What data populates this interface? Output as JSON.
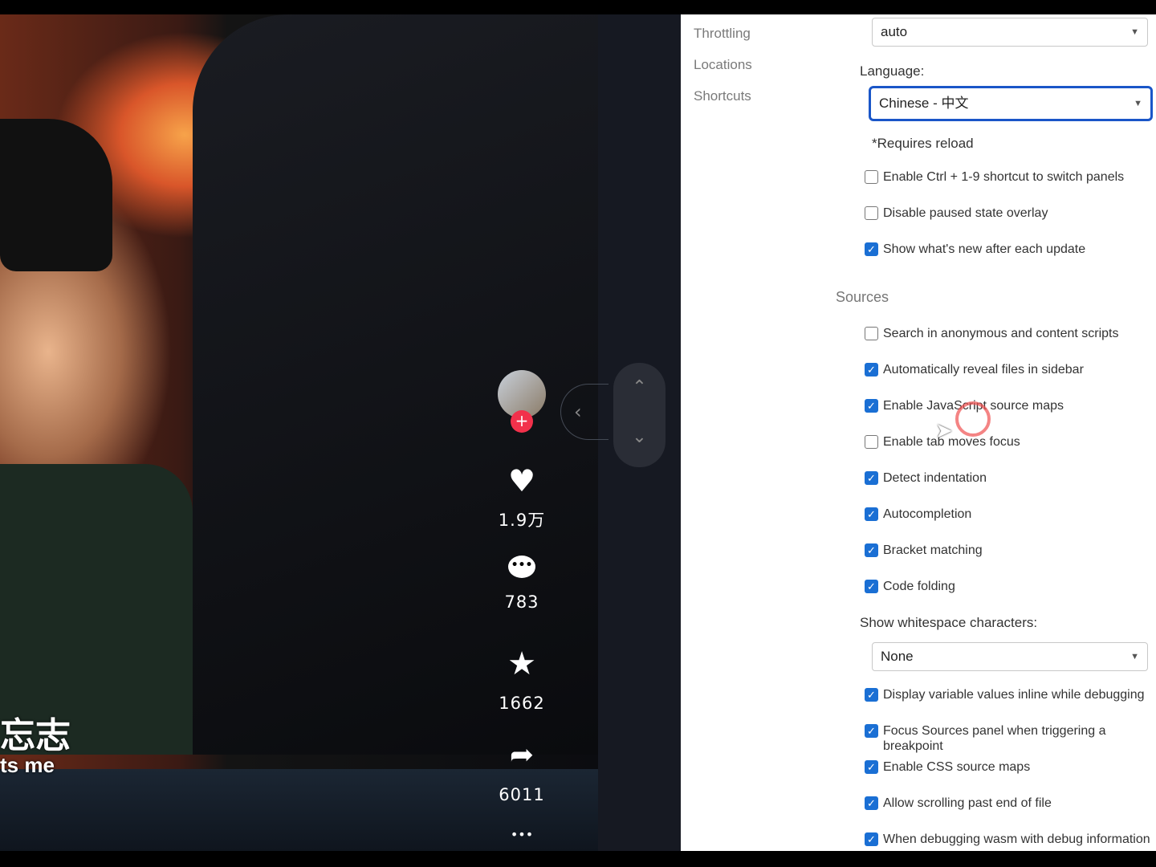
{
  "video": {
    "subtitle_cn": "忘志",
    "subtitle_en": "ts me"
  },
  "actions": {
    "likes": "1.9万",
    "comments": "783",
    "favorites": "1662",
    "shares": "6011",
    "more": "•••",
    "follow": "+"
  },
  "nav_arrows": {
    "up": "⌃",
    "down": "⌄",
    "collapse": "‹"
  },
  "settings": {
    "sidebar": [
      "Throttling",
      "Locations",
      "Shortcuts"
    ],
    "throttling_value": "auto",
    "language_label": "Language:",
    "language_value": "Chinese - 中文",
    "requires_reload": "*Requires reload",
    "appearance_options": [
      {
        "label": "Enable Ctrl + 1-9 shortcut to switch panels",
        "checked": false
      },
      {
        "label": "Disable paused state overlay",
        "checked": false
      },
      {
        "label": "Show what's new after each update",
        "checked": true
      }
    ],
    "sources_title": "Sources",
    "sources_options": [
      {
        "label": "Search in anonymous and content scripts",
        "checked": false
      },
      {
        "label": "Automatically reveal files in sidebar",
        "checked": true
      },
      {
        "label": "Enable JavaScript source maps",
        "checked": true
      },
      {
        "label": "Enable tab moves focus",
        "checked": false
      },
      {
        "label": "Detect indentation",
        "checked": true
      },
      {
        "label": "Autocompletion",
        "checked": true
      },
      {
        "label": "Bracket matching",
        "checked": true
      },
      {
        "label": "Code folding",
        "checked": true
      }
    ],
    "whitespace_label": "Show whitespace characters:",
    "whitespace_value": "None",
    "more_options": [
      {
        "label": "Display variable values inline while debugging",
        "checked": true
      },
      {
        "label": "Focus Sources panel when triggering a breakpoint",
        "checked": true
      },
      {
        "label": "Enable CSS source maps",
        "checked": true
      },
      {
        "label": "Allow scrolling past end of file",
        "checked": true
      },
      {
        "label": "When debugging wasm with debug information",
        "checked": true
      }
    ]
  },
  "colors": {
    "accent": "#1a6fd4",
    "follow": "#f2314b"
  }
}
